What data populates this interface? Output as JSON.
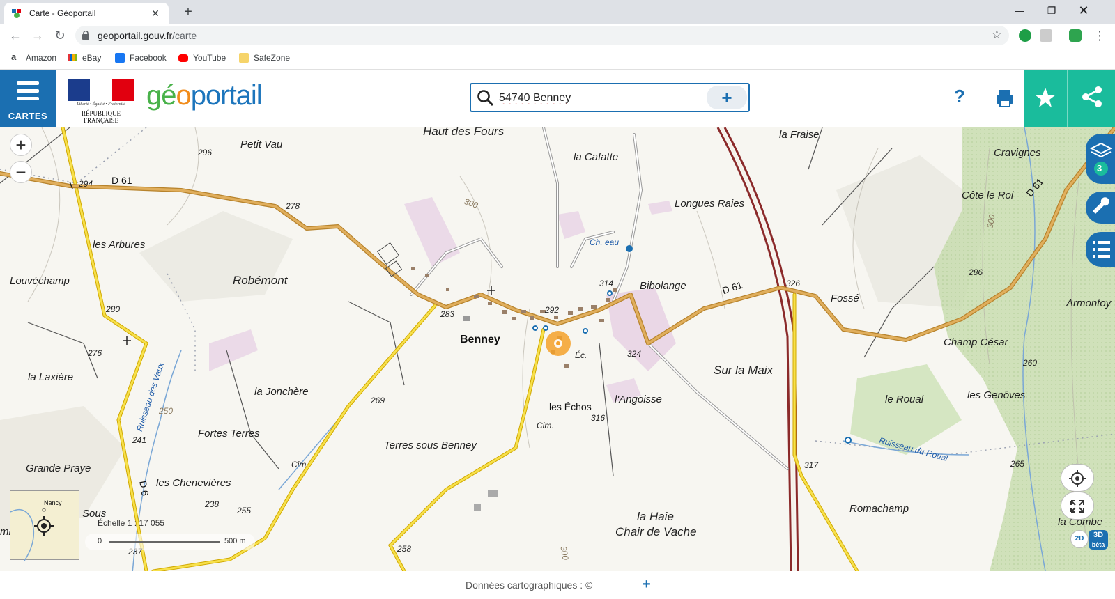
{
  "browser": {
    "tab_title": "Carte - Géoportail",
    "url_host": "geoportail.gouv.fr",
    "url_path": "/carte",
    "bookmarks": [
      "Amazon",
      "eBay",
      "Facebook",
      "YouTube",
      "SafeZone"
    ]
  },
  "header": {
    "menu_label": "CARTES",
    "rf_motto": "Liberté • Égalité • Fraternité",
    "rf_name": "RÉPUBLIQUE FRANÇAISE",
    "brand_g": "g",
    "brand_e": "é",
    "brand_o": "o",
    "brand_rest": "portail",
    "search_value": "54740 Benney",
    "search_add": "+",
    "help": "?"
  },
  "map": {
    "labels": {
      "haut_des_fours": "Haut des Fours",
      "petit_vau": "Petit Vau",
      "la_cafatte": "la Cafatte",
      "la_fraise": "la Fraise",
      "cravignes": "Cravignes",
      "cote_le_roi": "Côte le Roi",
      "longues_raies": "Longues Raies",
      "les_arbures": "les Arbures",
      "louvechamp": "Louvéchamp",
      "robemont": "Robémont",
      "bibolange": "Bibolange",
      "fosse": "Fossé",
      "armontoy": "Armontoy",
      "champ_cesar": "Champ César",
      "benney": "Benney",
      "la_laxiere": "la Laxière",
      "la_jonchere": "la Jonchère",
      "sur_la_maix": "Sur la Maix",
      "l_angoisse": "l'Angoisse",
      "les_echos": "les Échos",
      "le_roual": "le Roual",
      "les_genoves": "les Genôves",
      "fortes_terres": "Fortes Terres",
      "terres_sous_benney": "Terres sous Benney",
      "grande_praye": "Grande Praye",
      "les_chenevieres": "les Chenevières",
      "la_haie": "la Haie",
      "chair_de_vache": "Chair de Vache",
      "romachamp": "Romachamp",
      "la_comble": "la Combe",
      "sous": "Sous",
      "mb": "mb",
      "ch_eau": "Ch. eau",
      "ruisseau_du_roual": "Ruisseau du Roual",
      "ruisseau_des_vaux": "Ruisseau des Vaux",
      "ec": "Éc.",
      "cim1": "Cim.",
      "cim2": "Cim.",
      "d61_west": "D 61",
      "d61_mid": "D 61",
      "d61_east": "D 61",
      "d6": "D 6"
    },
    "altitudes": [
      "296",
      "294",
      "278",
      "300",
      "314",
      "326",
      "292",
      "283",
      "280",
      "276",
      "324",
      "269",
      "250",
      "241",
      "238",
      "255",
      "237",
      "258",
      "300",
      "316",
      "317",
      "300",
      "286",
      "260",
      "265",
      "300"
    ],
    "overview_label": "Nancy",
    "scale_text": "Échelle 1 : 17 055",
    "scale_zero": "0",
    "scale_len": "500 m",
    "layers_count": "3",
    "mode_2d": "2D",
    "mode_3d": "3D",
    "mode_beta": "bêta"
  },
  "footer": {
    "credits": "Données cartographiques : ©",
    "more": "+"
  },
  "colors": {
    "gp_blue": "#1b6fb1",
    "gp_teal": "#1abc9c",
    "road_main": "#d6a04a",
    "road_secondary": "#f2d232"
  }
}
